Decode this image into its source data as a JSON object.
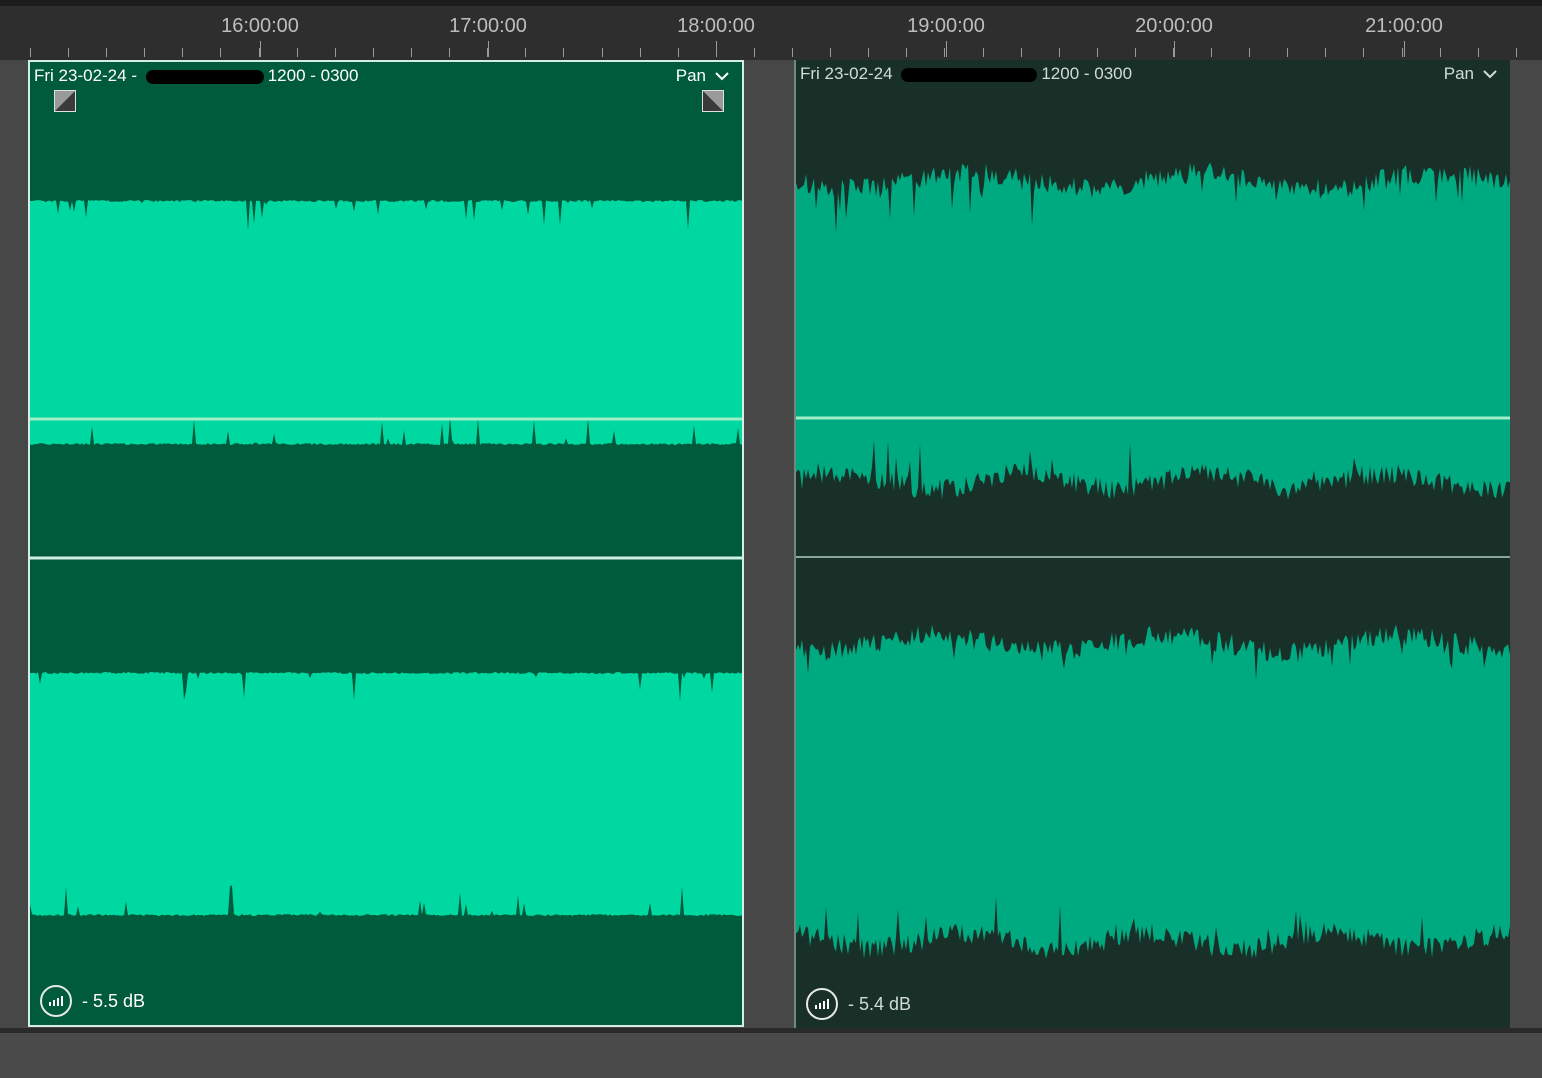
{
  "ruler": {
    "labels": [
      "16:00:00",
      "17:00:00",
      "18:00:00",
      "19:00:00",
      "20:00:00",
      "21:00:00"
    ]
  },
  "clips": [
    {
      "title_prefix": "Fri 23-02-24 - ",
      "title_suffix": "1200 - 0300",
      "pan_label": "Pan",
      "gain_label": "- 5.5 dB",
      "selected": true,
      "colors": {
        "wave": "#00d8a2",
        "background": "#005a3c",
        "center_line": "#9ff0c8"
      }
    },
    {
      "title_prefix": "Fri 23-02-24 ",
      "title_suffix": "1200 - 0300",
      "pan_label": "Pan",
      "gain_label": "- 5.4 dB",
      "selected": false,
      "colors": {
        "wave": "#00aa80",
        "background": "#193029",
        "center_line": "#9ff0c8"
      }
    }
  ],
  "icons": {
    "pan_dropdown": "chevron-down-icon",
    "gain": "volume-meter-icon",
    "fade_in": "fade-in-icon",
    "fade_out": "fade-out-icon"
  }
}
